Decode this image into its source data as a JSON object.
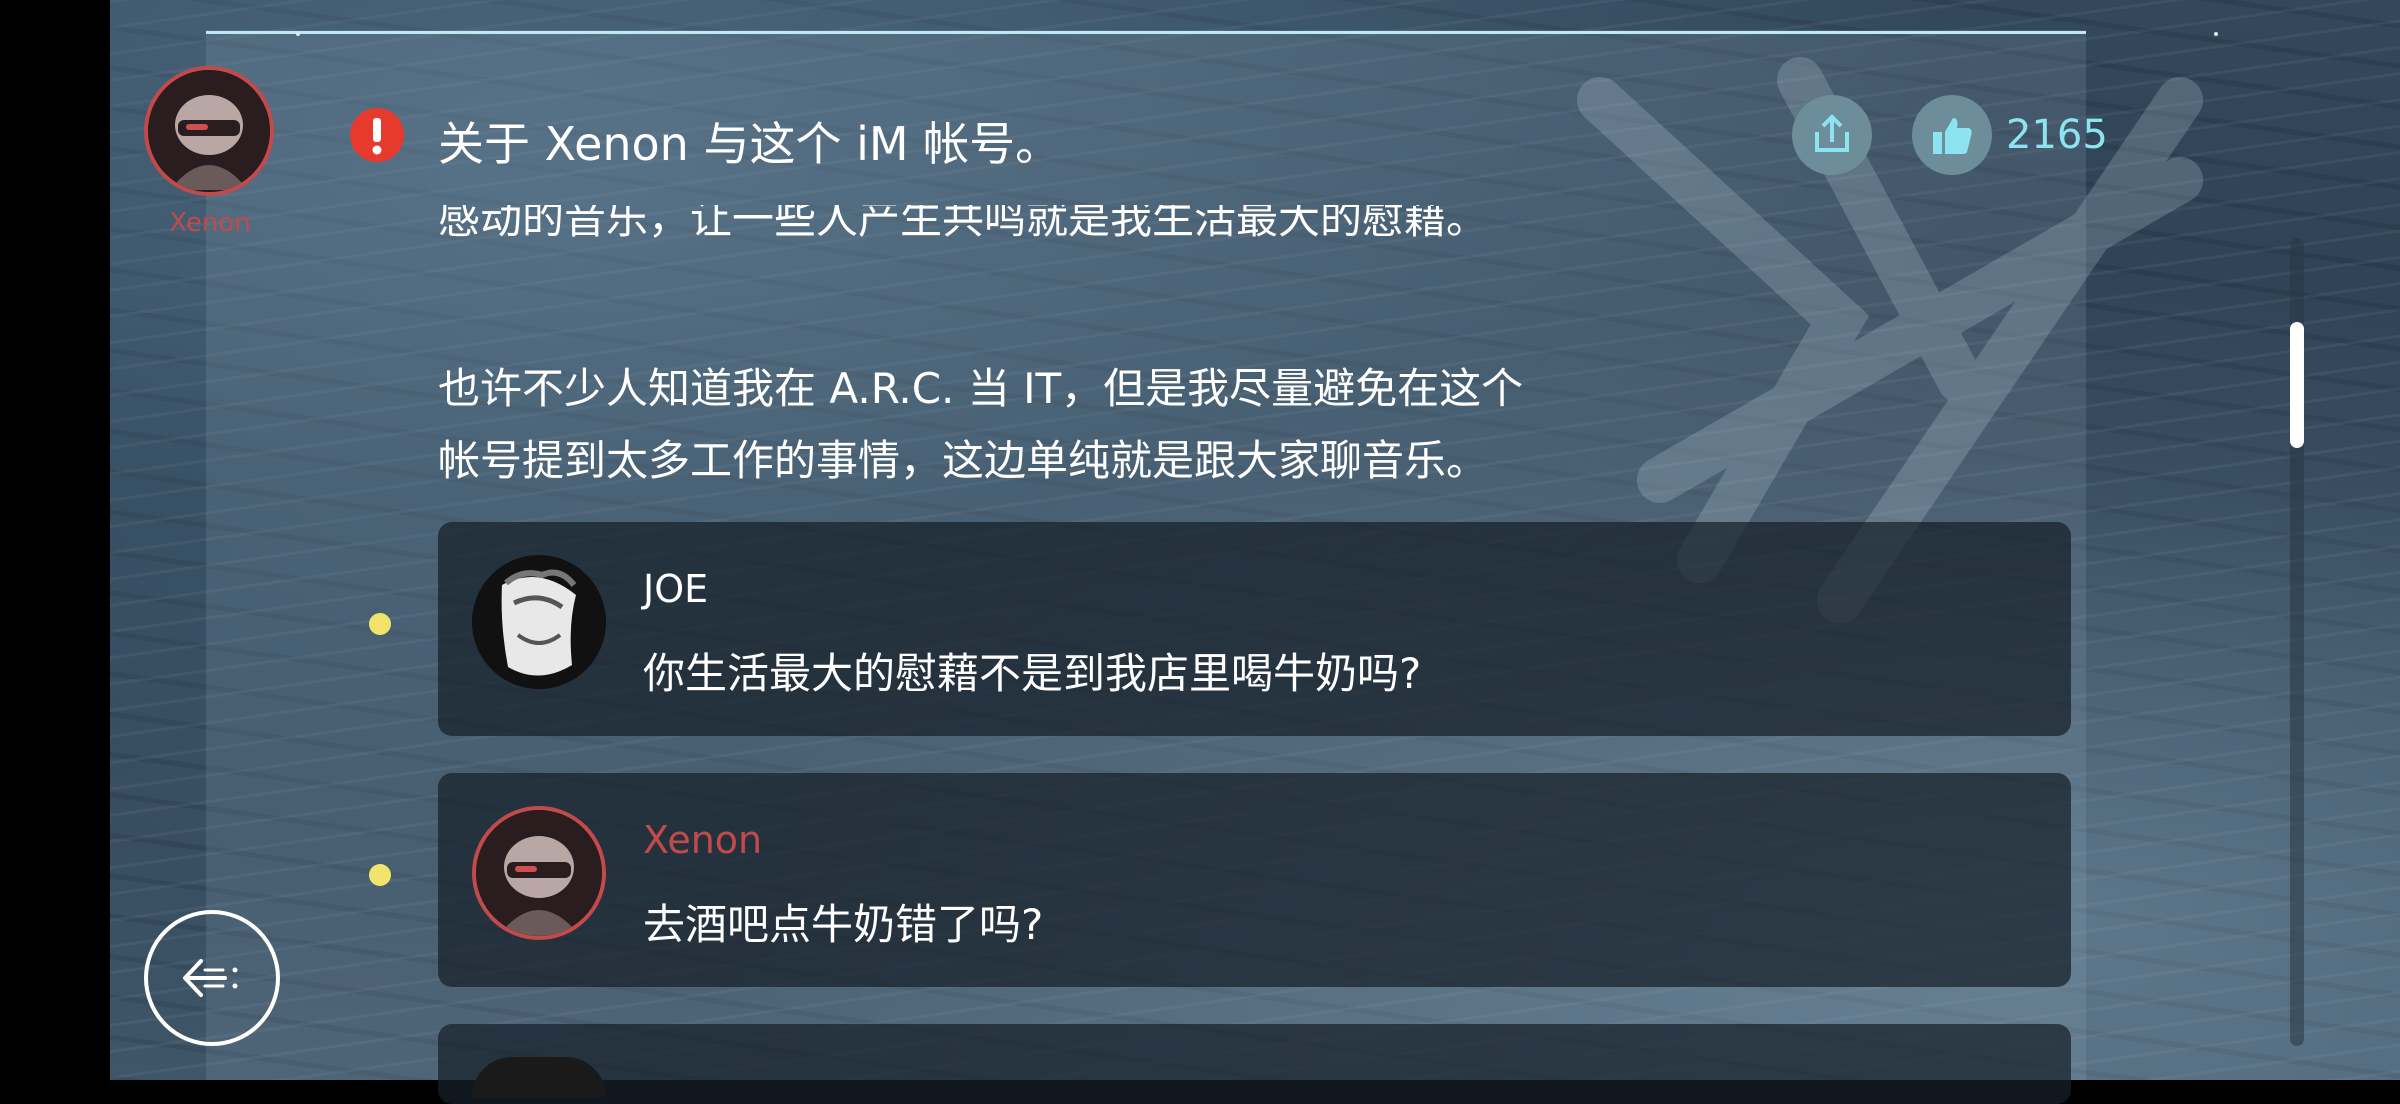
{
  "author": {
    "name": "Xenon",
    "color": "#c24a4a"
  },
  "post": {
    "title": "关于 Xenon 与这个 iM 帐号。",
    "likes": "2165",
    "clipped_line": "感动的音乐，让一些人产生共鸣就是我生活最大的慰藉。",
    "paragraph_lines": [
      "也许不少人知道我在 A.R.C. 当 IT，但是我尽量避免在这个",
      "帐号提到太多工作的事情，这边单纯就是跟大家聊音乐。"
    ]
  },
  "replies": [
    {
      "name": "JOE",
      "name_color": "#ffffff",
      "text": "你生活最大的慰藉不是到我店里喝牛奶吗?"
    },
    {
      "name": "Xenon",
      "name_color": "#c24a4a",
      "text": "去酒吧点牛奶错了吗?"
    }
  ],
  "scroll": {
    "position_fraction": 0.12
  },
  "colors": {
    "accent": "#8de3ef",
    "alert": "#e63a2e",
    "reply_dot": "#f2e46a"
  },
  "icons": [
    "alert-icon",
    "share-icon",
    "thumbs-up-icon",
    "back-icon"
  ]
}
